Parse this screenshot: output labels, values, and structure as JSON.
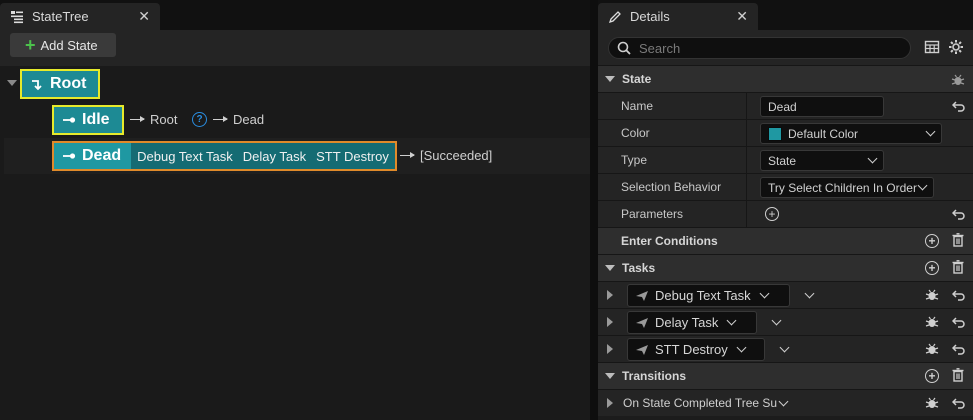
{
  "statetree": {
    "tab_title": "StateTree",
    "add_state_label": "Add State",
    "root": {
      "label": "Root"
    },
    "idle": {
      "label": "Idle",
      "transition_1": "Root",
      "transition_2": "Dead",
      "help": "?"
    },
    "dead": {
      "label": "Dead",
      "tasks": [
        "Debug Text Task",
        "Delay Task",
        "STT Destroy"
      ],
      "transition": "[Succeeded]"
    }
  },
  "details": {
    "tab_title": "Details",
    "search_placeholder": "Search",
    "state_category": "State",
    "props": {
      "name_label": "Name",
      "name_value": "Dead",
      "color_label": "Color",
      "color_value": "Default Color",
      "color_swatch": "#1f98a2",
      "type_label": "Type",
      "type_value": "State",
      "selection_label": "Selection Behavior",
      "selection_value": "Try Select Children In Order",
      "parameters_label": "Parameters"
    },
    "enter_conditions": "Enter Conditions",
    "tasks_category": "Tasks",
    "tasks": [
      "Debug Text Task",
      "Delay Task",
      "STT Destroy"
    ],
    "transitions_category": "Transitions",
    "transition_item": "On State Completed Tree Su"
  },
  "colors": {
    "node_teal": "#1d8a94",
    "highlight_yellow": "#e6ea2b",
    "selected_orange": "#e08a2a",
    "add_green": "#4cc24c"
  }
}
